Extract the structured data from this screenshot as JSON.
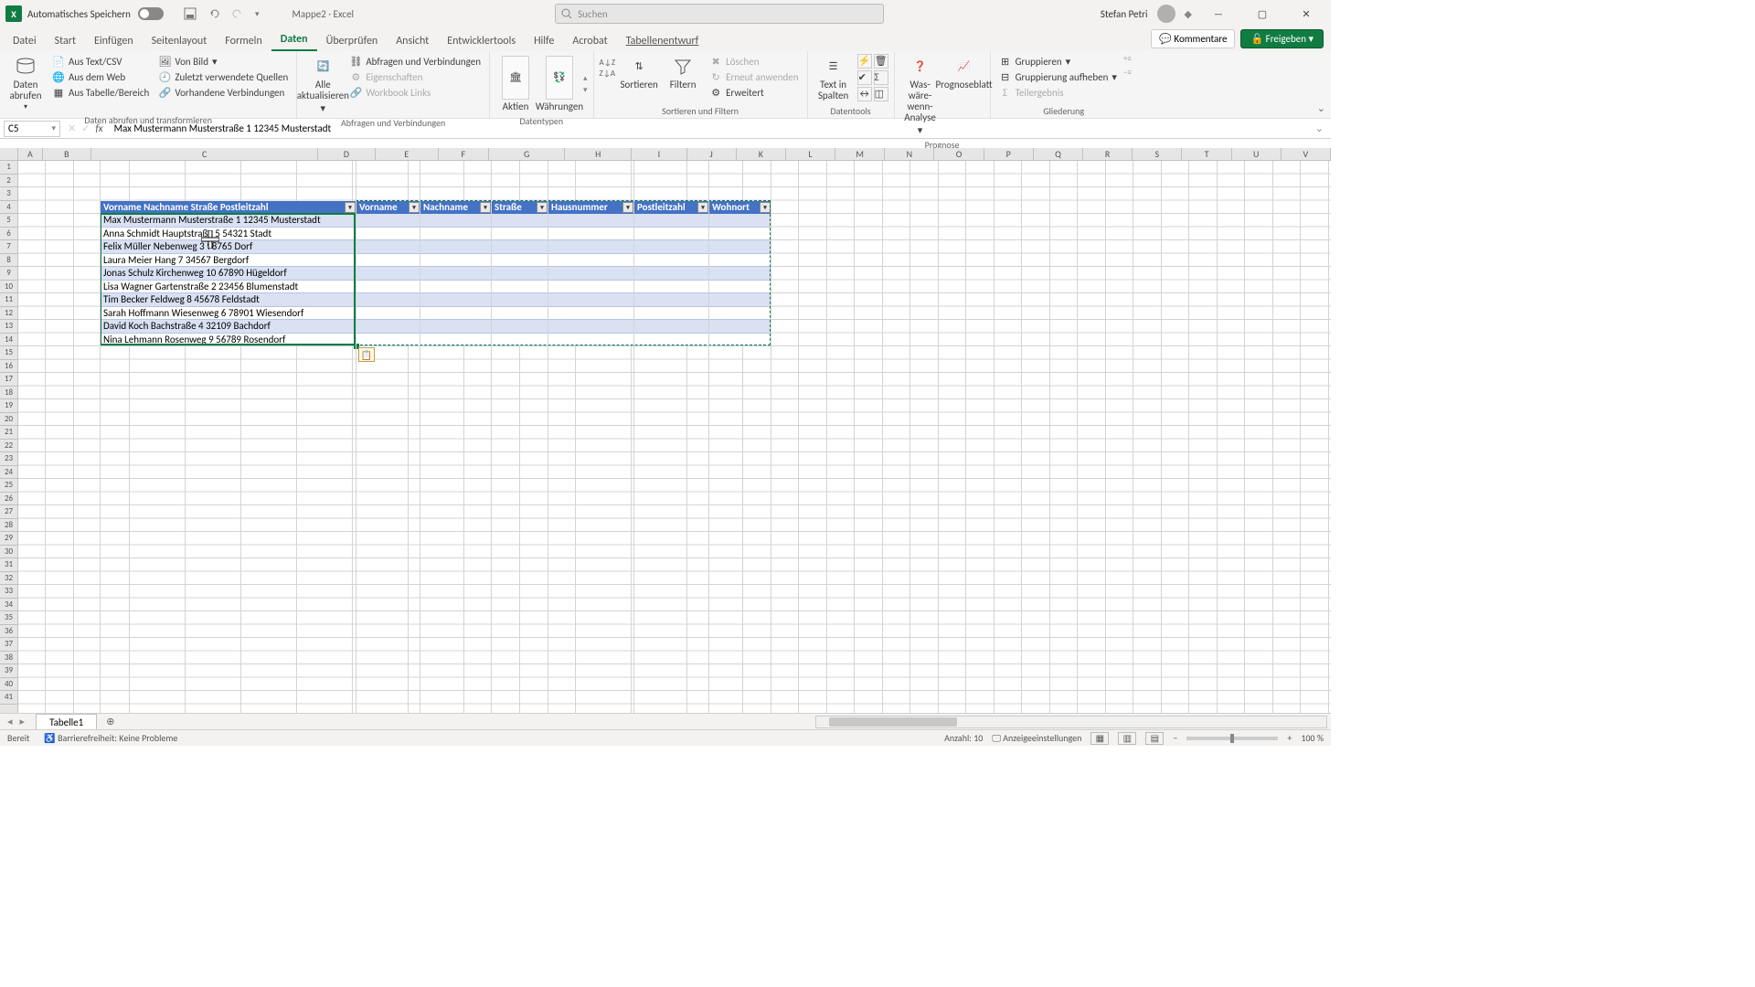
{
  "titlebar": {
    "autosave_label": "Automatisches Speichern",
    "doc_name": "Mappe2",
    "app_name": "Excel",
    "search_placeholder": "Suchen",
    "user_name": "Stefan Petri"
  },
  "tabs": {
    "items": [
      "Datei",
      "Start",
      "Einfügen",
      "Seitenlayout",
      "Formeln",
      "Daten",
      "Überprüfen",
      "Ansicht",
      "Entwicklertools",
      "Hilfe",
      "Acrobat",
      "Tabellenentwurf"
    ],
    "active_index": 5,
    "comments_label": "Kommentare",
    "share_label": "Freigeben"
  },
  "ribbon": {
    "group_import_label": "Daten abrufen und transformieren",
    "btn_get_data": "Daten abrufen",
    "btn_text_csv": "Aus Text/CSV",
    "btn_from_web": "Aus dem Web",
    "btn_from_table": "Aus Tabelle/Bereich",
    "btn_from_image": "Von Bild",
    "btn_recent": "Zuletzt verwendete Quellen",
    "btn_existing": "Vorhandene Verbindungen",
    "group_queries_label": "Abfragen und Verbindungen",
    "btn_refresh_all": "Alle aktualisieren",
    "btn_queries_conn": "Abfragen und Verbindungen",
    "btn_properties": "Eigenschaften",
    "btn_workbook_links": "Workbook Links",
    "group_datatypes_label": "Datentypen",
    "btn_stocks": "Aktien",
    "btn_currencies": "Währungen",
    "group_sortfilter_label": "Sortieren und Filtern",
    "btn_sort": "Sortieren",
    "btn_filter": "Filtern",
    "btn_clear": "Löschen",
    "btn_reapply": "Erneut anwenden",
    "btn_advanced": "Erweitert",
    "group_datatools_label": "Datentools",
    "btn_text_to_cols": "Text in Spalten",
    "group_forecast_label": "Prognose",
    "btn_whatif": "Was-wäre-wenn-Analyse",
    "btn_forecast_sheet": "Prognoseblatt",
    "group_outline_label": "Gliederung",
    "btn_group": "Gruppieren",
    "btn_ungroup": "Gruppierung aufheben",
    "btn_subtotal": "Teilergebnis"
  },
  "formulabar": {
    "name_box": "C5",
    "formula": "Max Mustermann Musterstraße 1 12345 Musterstadt"
  },
  "columns": [
    "A",
    "B",
    "C",
    "D",
    "E",
    "F",
    "G",
    "H",
    "I",
    "J",
    "K",
    "L",
    "M",
    "N",
    "O",
    "P",
    "Q",
    "R",
    "S",
    "T",
    "U",
    "V"
  ],
  "col_widths": {
    "A": 30,
    "B": 60,
    "C": 280,
    "D": 70,
    "E": 78,
    "F": 62,
    "G": 94,
    "H": 82,
    "I": 68
  },
  "default_col_width": 61,
  "row_count": 41,
  "table1": {
    "header": "Vorname Nachname Straße Postleitzahl",
    "rows": [
      "Max Mustermann Musterstraße 1 12345 Musterstadt",
      "Anna Schmidt Hauptstraße 5 54321 Stadt",
      "Felix Müller Nebenweg 3 98765 Dorf",
      "Laura Meier Hang 7 34567 Bergdorf",
      "Jonas Schulz Kirchenweg 10 67890 Hügeldorf",
      "Lisa Wagner Gartenstraße 2 23456 Blumenstadt",
      "Tim Becker Feldweg 8 45678 Feldstadt",
      "Sarah Hoffmann Wiesenweg 6 78901 Wiesendorf",
      "David Koch Bachstraße 4 32109 Bachdorf",
      "Nina Lehmann Rosenweg 9 56789 Rosendorf"
    ]
  },
  "table2_headers": [
    "Vorname",
    "Nachname",
    "Straße",
    "Hausnummer",
    "Postleitzahl",
    "Wohnort"
  ],
  "sheet": {
    "name": "Tabelle1"
  },
  "statusbar": {
    "ready": "Bereit",
    "accessibility": "Barrierefreiheit: Keine Probleme",
    "count_label": "Anzahl:",
    "count_value": "10",
    "display_settings": "Anzeigeeinstellungen",
    "zoom": "100 %"
  },
  "chart_data": null
}
